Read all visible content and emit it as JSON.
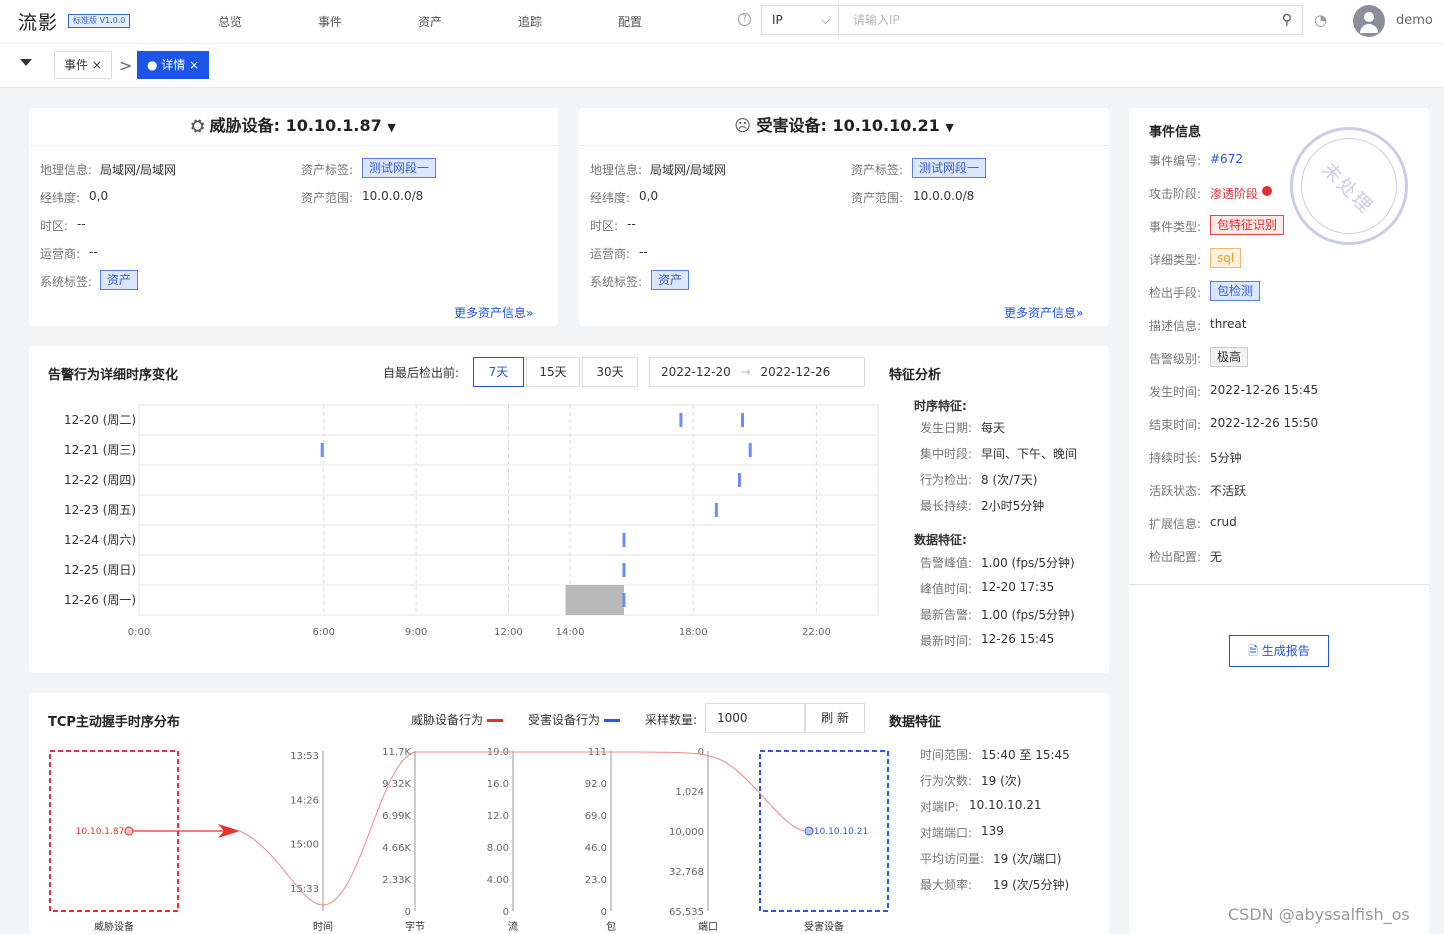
{
  "app": {
    "logo": "流影",
    "version": "标准版 V1.0.0",
    "user": "demo"
  },
  "nav": [
    "总览",
    "事件",
    "资产",
    "追踪",
    "配置"
  ],
  "search": {
    "type": "IP",
    "placeholder": "请输入IP"
  },
  "tabs": [
    {
      "label": "事件",
      "close": "×"
    },
    {
      "label": "● 详情",
      "close": "×"
    }
  ],
  "threat": {
    "title": "威胁设备: 10.10.1.87",
    "geo_l": "地理信息:",
    "geo": "局域网/局域网",
    "ll_l": "经纬度:",
    "ll": "0,0",
    "tz_l": "时区:",
    "tz": "--",
    "isp_l": "运营商:",
    "isp": "--",
    "sys_l": "系统标签:",
    "sys": "资产",
    "tag_l": "资产标签:",
    "tag": "测试网段一",
    "range_l": "资产范围:",
    "range": "10.0.0.0/8",
    "more": "更多资产信息»"
  },
  "victim": {
    "title": "受害设备: 10.10.10.21",
    "geo_l": "地理信息:",
    "geo": "局域网/局域网",
    "ll_l": "经纬度:",
    "ll": "0,0",
    "tz_l": "时区:",
    "tz": "--",
    "isp_l": "运营商:",
    "isp": "--",
    "sys_l": "系统标签:",
    "sys": "资产",
    "tag_l": "资产标签:",
    "tag": "测试网段一",
    "range_l": "资产范围:",
    "range": "10.0.0.0/8",
    "more": "更多资产信息»"
  },
  "alarm": {
    "title": "告警行为详细时序变化",
    "since": "自最后检出前:",
    "ranges": [
      "7天",
      "15天",
      "30天"
    ],
    "date_from": "2022-12-20",
    "date_arrow": "→",
    "date_to": "2022-12-26"
  },
  "feature": {
    "title": "特征分析",
    "ts_title": "时序特征:",
    "ts": [
      [
        "发生日期:",
        "每天"
      ],
      [
        "集中时段:",
        "早间、下午、晚间"
      ],
      [
        "行为检出:",
        "8 (次/7天)"
      ],
      [
        "最长持续:",
        "2小时5分钟"
      ]
    ],
    "data_title": "数据特征:",
    "data": [
      [
        "告警峰值:",
        "1.00 (fps/5分钟)"
      ],
      [
        "峰值时间:",
        "12-20 17:35"
      ],
      [
        "最新告警:",
        "1.00 (fps/5分钟)"
      ],
      [
        "最新时间:",
        "12-26 15:45"
      ]
    ]
  },
  "event": {
    "title": "事件信息",
    "stamp": "未处理",
    "rows": [
      [
        "事件编号:",
        "#672"
      ],
      [
        "攻击阶段:",
        "渗透阶段"
      ],
      [
        "事件类型:",
        "包特征识别"
      ],
      [
        "详细类型:",
        "sql"
      ],
      [
        "检出手段:",
        "包检测"
      ],
      [
        "描述信息:",
        "threat"
      ],
      [
        "告警级别:",
        "极高"
      ],
      [
        "发生时间:",
        "2022-12-26 15:45"
      ],
      [
        "结束时间:",
        "2022-12-26 15:50"
      ],
      [
        "持续时长:",
        "5分钟"
      ],
      [
        "活跃状态:",
        "不活跃"
      ],
      [
        "扩展信息:",
        "crud"
      ],
      [
        "检出配置:",
        "无"
      ]
    ],
    "report": "生成报告"
  },
  "tcp": {
    "title": "TCP主动握手时序分布",
    "legend_threat": "威胁设备行为",
    "legend_victim": "受害设备行为",
    "sample_l": "采样数量:",
    "sample": "1000",
    "refresh": "刷 新",
    "src_ip": "10.10.1.87",
    "dst_ip": "10.10.10.21",
    "src_label": "威胁设备",
    "dst_label": "受害设备"
  },
  "tcp_feature": {
    "title": "数据特征",
    "rows": [
      [
        "时间范围:",
        "15:40 至 15:45"
      ],
      [
        "行为次数:",
        "19 (次)"
      ],
      [
        "对端IP:",
        "10.10.10.21"
      ],
      [
        "对端端口:",
        "139"
      ],
      [
        "平均访问量:",
        "19 (次/端口)"
      ],
      [
        "最大频率:",
        "19 (次/5分钟)"
      ]
    ]
  },
  "watermark": "CSDN @abyssalfish_os",
  "chart_data": [
    {
      "type": "scatter",
      "title": "告警行为详细时序变化",
      "categories": [
        "12-20 (周二)",
        "12-21 (周三)",
        "12-22 (周四)",
        "12-23 (周五)",
        "12-24 (周六)",
        "12-25 (周日)",
        "12-26 (周一)"
      ],
      "x_ticks": [
        "0:00",
        "6:00",
        "9:00",
        "12:00",
        "14:00",
        "18:00",
        "22:00"
      ],
      "x_tick_hours": [
        0,
        6,
        9,
        12,
        14,
        18,
        22
      ],
      "xlim": [
        0,
        24
      ],
      "points": [
        {
          "day": 0,
          "hour": 17.6
        },
        {
          "day": 0,
          "hour": 19.6
        },
        {
          "day": 1,
          "hour": 5.95
        },
        {
          "day": 1,
          "hour": 19.85
        },
        {
          "day": 2,
          "hour": 19.5
        },
        {
          "day": 3,
          "hour": 18.75
        },
        {
          "day": 4,
          "hour": 15.75
        },
        {
          "day": 5,
          "hour": 15.75
        },
        {
          "day": 6,
          "hour": 15.75
        }
      ],
      "highlight": {
        "day": 6,
        "from": 13.85,
        "to": 15.75
      },
      "point_color": "#6b8cff"
    },
    {
      "type": "parallel",
      "title": "TCP主动握手时序分布",
      "axes": [
        {
          "label": "时间",
          "ticks": [
            "13:53",
            "14:26",
            "15:00",
            "15:33"
          ]
        },
        {
          "label": "字节",
          "ticks": [
            "11.7K",
            "9.32K",
            "6.99K",
            "4.66K",
            "2.33K",
            "0"
          ]
        },
        {
          "label": "流",
          "ticks": [
            "19.0",
            "16.0",
            "12.0",
            "8.00",
            "4.00",
            "0"
          ]
        },
        {
          "label": "包",
          "ticks": [
            "111",
            "92.0",
            "69.0",
            "46.0",
            "23.0",
            "0"
          ]
        },
        {
          "label": "端口",
          "ticks": [
            "0",
            "1,024",
            "10,000",
            "32,768",
            "65,535"
          ]
        }
      ]
    }
  ]
}
